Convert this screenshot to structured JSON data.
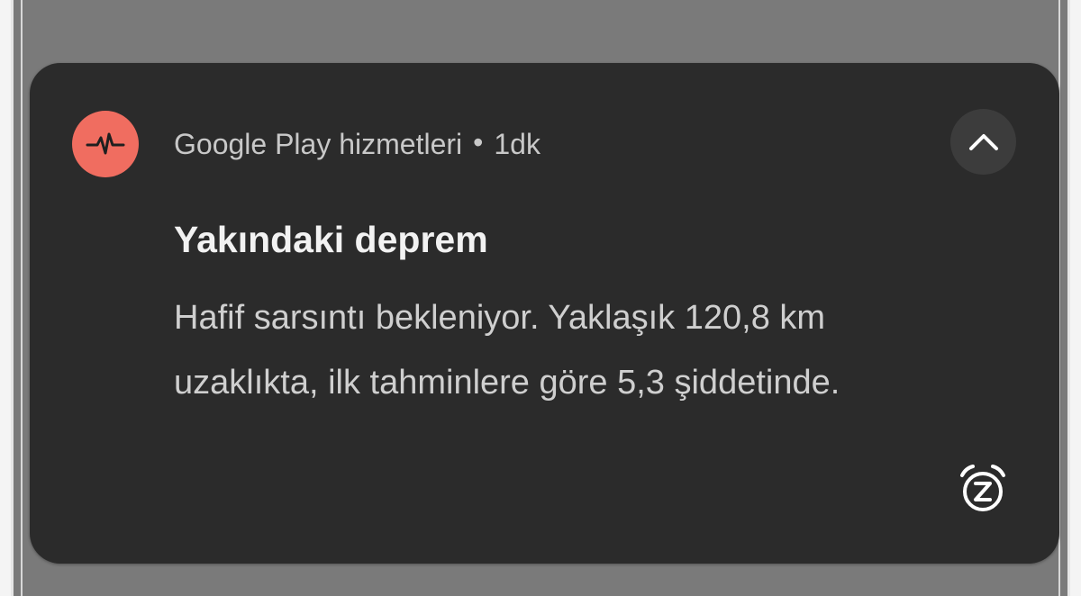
{
  "notification": {
    "app_name": "Google Play hizmetleri",
    "separator": "•",
    "time": "1dk",
    "title": "Yakındaki deprem",
    "body_line1": "Hafif sarsıntı bekleniyor. Yaklaşık 120,8 km",
    "body_line2": "uzaklıkta, ilk tahminlere göre 5,3 şiddetinde.",
    "icons": {
      "app": "earthquake-pulse-icon",
      "collapse": "chevron-up-icon",
      "snooze": "snooze-alarm-icon"
    },
    "colors": {
      "card_background": "#2b2b2b",
      "app_icon_background": "#f06d60",
      "title_text": "#f2f2f2",
      "body_text": "#cfcfcf"
    }
  }
}
